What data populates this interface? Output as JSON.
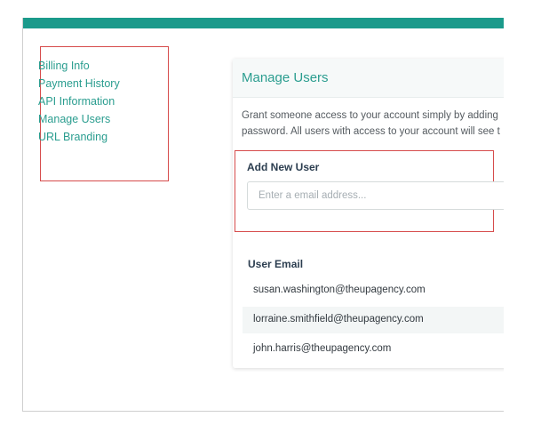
{
  "sidebar": {
    "items": [
      {
        "label": "Billing Info"
      },
      {
        "label": "Payment History"
      },
      {
        "label": "API Information"
      },
      {
        "label": "Manage Users"
      },
      {
        "label": "URL Branding"
      }
    ]
  },
  "card": {
    "title": "Manage Users",
    "description_line1": "Grant someone access to your account simply by adding",
    "description_line2": "password. All users with access to your account will see t"
  },
  "add_user": {
    "label": "Add New User",
    "placeholder": "Enter a email address...",
    "value": ""
  },
  "users_table": {
    "header": "User Email",
    "rows": [
      {
        "email": "susan.washington@theupagency.com"
      },
      {
        "email": "lorraine.smithfield@theupagency.com"
      },
      {
        "email": "john.harris@theupagency.com"
      }
    ]
  },
  "colors": {
    "accent": "#1b9a8b",
    "link": "#2a9d8f",
    "highlight_box": "#d64b4b"
  }
}
